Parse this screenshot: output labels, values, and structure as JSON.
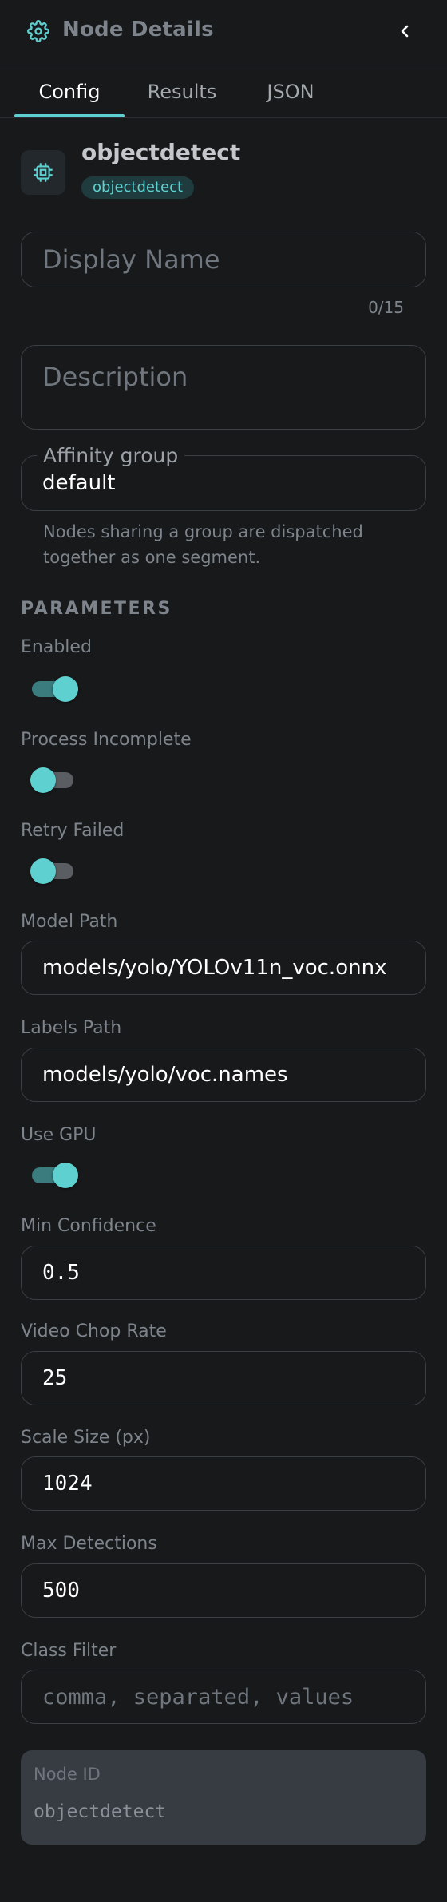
{
  "header": {
    "title": "Node Details"
  },
  "tabs": [
    {
      "label": "Config",
      "active": true
    },
    {
      "label": "Results",
      "active": false
    },
    {
      "label": "JSON",
      "active": false
    }
  ],
  "node": {
    "title": "objectdetect",
    "badge": "objectdetect"
  },
  "display_name": {
    "value": "",
    "placeholder": "Display Name",
    "counter": "0/15"
  },
  "description": {
    "value": "",
    "placeholder": "Description"
  },
  "affinity": {
    "label": "Affinity group",
    "value": "default",
    "helper": "Nodes sharing a group are dispatched together as one segment."
  },
  "parameters": {
    "title": "PARAMETERS",
    "enabled": {
      "label": "Enabled",
      "on": true
    },
    "process_incomplete": {
      "label": "Process Incomplete",
      "on": false
    },
    "retry_failed": {
      "label": "Retry Failed",
      "on": false
    },
    "model_path": {
      "label": "Model Path",
      "value": "models/yolo/YOLOv11n_voc.onnx"
    },
    "labels_path": {
      "label": "Labels Path",
      "value": "models/yolo/voc.names"
    },
    "use_gpu": {
      "label": "Use GPU",
      "on": true
    },
    "min_confidence": {
      "label": "Min Confidence",
      "value": "0.5"
    },
    "video_chop_rate": {
      "label": "Video Chop Rate",
      "value": "25"
    },
    "scale_size": {
      "label": "Scale Size (px)",
      "value": "1024"
    },
    "max_detections": {
      "label": "Max Detections",
      "value": "500"
    },
    "class_filter": {
      "label": "Class Filter",
      "value": "",
      "placeholder": "comma, separated, values"
    }
  },
  "node_id": {
    "label": "Node ID",
    "value": "objectdetect"
  },
  "colors": {
    "accent": "#5fd0d0",
    "background": "#17191b",
    "border": "#3a3f44"
  }
}
